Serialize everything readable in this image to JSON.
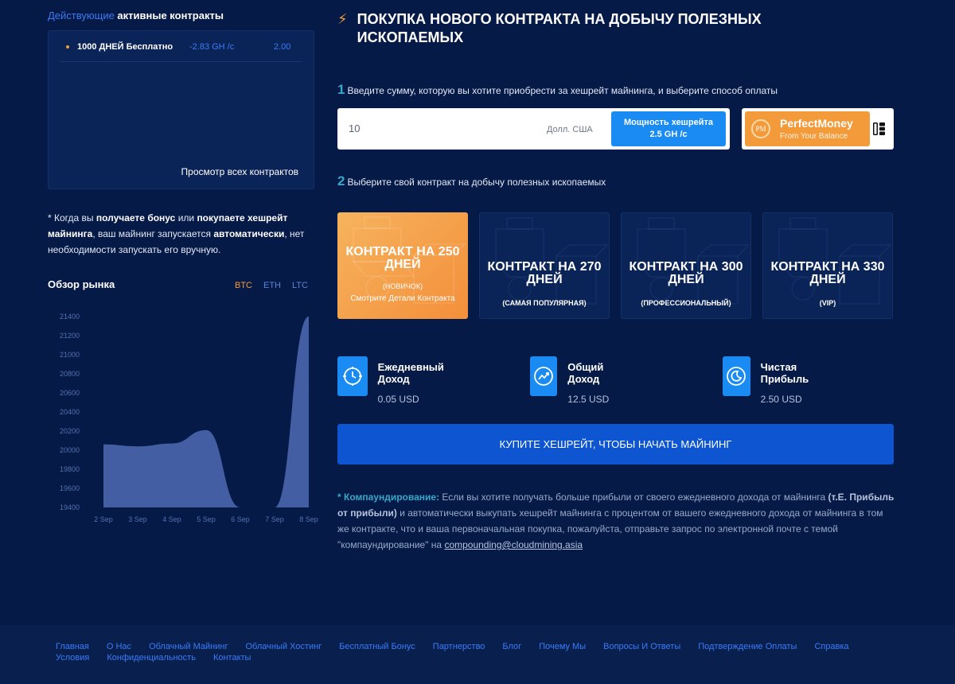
{
  "sidebar": {
    "active_title_prefix": "Действующие",
    "active_title_rest": " активные контракты",
    "contracts": [
      {
        "name": "1000 ДНЕЙ Бесплатно",
        "speed": "-2.83 GH /с",
        "value": "2.00"
      }
    ],
    "view_all": "Просмотр всех контрактов",
    "note": {
      "star": "* Когда вы ",
      "b1": "получаете бонус",
      "t1": " или ",
      "b2": "покупаете хешрейт майнинга",
      "t2": ", ваш майнинг запускается ",
      "b3": "автоматически",
      "t3": ", нет необходимости запускать его вручную."
    },
    "market": {
      "title": "Обзор рынка",
      "tabs": [
        "BTC",
        "ETH",
        "LTC"
      ],
      "active_tab": "BTC"
    }
  },
  "chart_data": {
    "type": "area",
    "title": "",
    "x": [
      "2 Sep",
      "3 Sep",
      "4 Sep",
      "5 Sep",
      "6 Sep",
      "7 Sep",
      "8 Sep"
    ],
    "series": [
      {
        "values": [
          20060,
          20040,
          20070,
          20210,
          19400,
          19400,
          21410
        ]
      }
    ],
    "ylim": [
      19400,
      21400
    ],
    "yticks": [
      21400,
      21200,
      21000,
      20800,
      20600,
      20400,
      20200,
      20000,
      19800,
      19600,
      19400
    ],
    "grid": false,
    "color": "#4b66ad"
  },
  "main": {
    "bolt": "⚡",
    "title": "ПОКУПКА НОВОГО КОНТРАКТА НА ДОБЫЧУ ПОЛЕЗНЫХ ИСКОПАЕМЫХ",
    "step1_num": "1",
    "step1_text": "Введите сумму, которую вы хотите приобрести за хешрейт майнинга, и выберите способ оплаты",
    "amount": "10",
    "currency": "Долл. США",
    "hashrate_label": "Мощность хешрейта",
    "hashrate_value": "2.5 GH /с",
    "payment": {
      "name": "PerfectMoney",
      "sub": "From Your Balance",
      "logo": "PM"
    },
    "step2_num": "2",
    "step2_text": "Выберите свой контракт на добычу полезных ископаемых",
    "cards": [
      {
        "title": "КОНТРАКТ НА 250 ДНЕЙ",
        "sub": "(НОВИЧОК)",
        "details": "Смотрите Детали Контракта",
        "active": true
      },
      {
        "title": "КОНТРАКТ НА 270 ДНЕЙ",
        "sub": "(САМАЯ ПОПУЛЯРНАЯ)",
        "active": false
      },
      {
        "title": "КОНТРАКТ НА 300 ДНЕЙ",
        "sub": "(ПРОФЕССИОНАЛЬНЫЙ)",
        "active": false
      },
      {
        "title": "КОНТРАКТ НА 330 ДНЕЙ",
        "sub": "(VIP)",
        "active": false
      }
    ],
    "stats": [
      {
        "label": "Ежедневный Доход",
        "value": "0.05 USD",
        "icon": "target-clock-icon"
      },
      {
        "label": "Общий Доход",
        "value": "12.5 USD",
        "icon": "trend-up-icon"
      },
      {
        "label": "Чистая Прибыль",
        "value": "2.50 USD",
        "icon": "moon-clock-icon"
      }
    ],
    "buy_button": "КУПИТЕ ХЕШРЕЙТ, ЧТОБЫ НАЧАТЬ МАЙНИНГ",
    "compound": {
      "star": "* Компаундирование:",
      "t1": " Если вы хотите получать больше прибыли от своего ежедневного дохода от майнинга ",
      "b1": "(т.Е. Прибыль от прибыли)",
      "t2": " и автоматически выкупать хешрейт майнинга с процентом от вашего ежедневного дохода от майнинга в том же контракте, что и ваша первоначальная покупка, пожалуйста, отправьте запрос по электронной почте с темой \"компаундирование\" на ",
      "email": "compounding@cloudmining.asia"
    }
  },
  "footer": {
    "links": [
      "Главная",
      "О Нас",
      "Облачный Майнинг",
      "Облачный Хостинг",
      "Бесплатный Бонус",
      "Партнерство",
      "Блог",
      "Почему Мы",
      "Вопросы И Ответы",
      "Подтверждение Оплаты",
      "Справка",
      "Условия",
      "Конфиденциальность",
      "Контакты"
    ]
  }
}
